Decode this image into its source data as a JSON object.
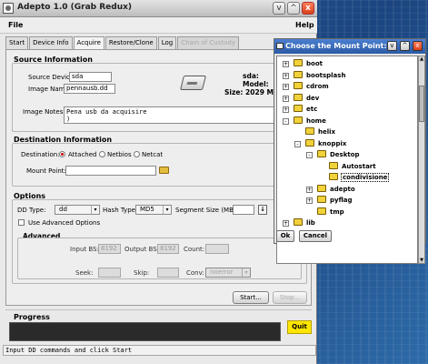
{
  "window": {
    "title": "Adepto 1.0 (Grab Redux)",
    "controls": [
      "v",
      "^",
      "x"
    ]
  },
  "menu": {
    "file": "File",
    "help": "Help"
  },
  "tabs": [
    {
      "label": "Start",
      "state": "normal"
    },
    {
      "label": "Device Info",
      "state": "normal"
    },
    {
      "label": "Acquire",
      "state": "active"
    },
    {
      "label": "Restore/Clone",
      "state": "normal"
    },
    {
      "label": "Log",
      "state": "normal"
    },
    {
      "label": "Chain of Custody",
      "state": "disabled"
    }
  ],
  "source": {
    "title": "Source Information",
    "device_label": "Source Device:",
    "device_value": "sda",
    "image_label": "Image Name:",
    "image_value": "pennausb.dd",
    "info_device": "sda:",
    "info_model": "Model:",
    "info_size": "Size: 2029 MB",
    "notes_label": "Image Notes:",
    "notes_value": "Pena usb da acquisire\n)"
  },
  "destination": {
    "title": "Destination Information",
    "dest_label": "Destination:",
    "options": [
      "Attached",
      "Netbios",
      "Netcat"
    ],
    "selected": "Attached",
    "mount_label": "Mount Point:",
    "mount_value": ""
  },
  "options": {
    "title": "Options",
    "dd_type_label": "DD Type:",
    "dd_type_value": "dd",
    "hash_type_label": "Hash Type:",
    "hash_type_value": "MD5",
    "segment_label": "Segment Size (MB):",
    "segment_value": "",
    "advanced_checkbox_label": "Use Advanced Options",
    "advanced_title": "Advanced",
    "input_bs_label": "Input BS:",
    "input_bs_value": "8192",
    "output_bs_label": "Output BS:",
    "output_bs_value": "8192",
    "count_label": "Count:",
    "count_value": "",
    "seek_label": "Seek:",
    "seek_value": "",
    "skip_label": "Skip:",
    "skip_value": "",
    "conv_label": "Conv:",
    "conv_value": "noerror"
  },
  "actions": {
    "start": "Start...",
    "stop": "Stop..."
  },
  "progress": {
    "title": "Progress",
    "quit": "Quit"
  },
  "status": "Input DD commands and click Start",
  "dialog": {
    "title": "Choose the Mount Point:",
    "controls": [
      "v",
      "^",
      "x"
    ],
    "items": [
      {
        "label": "boot",
        "level": 0,
        "expander": "+"
      },
      {
        "label": "bootsplash",
        "level": 0,
        "expander": "+"
      },
      {
        "label": "cdrom",
        "level": 0,
        "expander": "+"
      },
      {
        "label": "dev",
        "level": 0,
        "expander": "+"
      },
      {
        "label": "etc",
        "level": 0,
        "expander": "+"
      },
      {
        "label": "home",
        "level": 0,
        "expander": "-"
      },
      {
        "label": "helix",
        "level": 1,
        "expander": ""
      },
      {
        "label": "knoppix",
        "level": 1,
        "expander": "-"
      },
      {
        "label": "Desktop",
        "level": 2,
        "expander": "-"
      },
      {
        "label": "Autostart",
        "level": 3,
        "expander": ""
      },
      {
        "label": "condivisione",
        "level": 3,
        "expander": "",
        "selected": true
      },
      {
        "label": "adepto",
        "level": 2,
        "expander": "+"
      },
      {
        "label": "pyflag",
        "level": 2,
        "expander": "+"
      },
      {
        "label": "tmp",
        "level": 2,
        "expander": ""
      },
      {
        "label": "lib",
        "level": 0,
        "expander": "+"
      }
    ],
    "ok": "Ok",
    "cancel": "Cancel"
  },
  "colors": {
    "quit_button": "#ffe600",
    "dialog_title": "#2a5aa6",
    "folder": "#f1d23a",
    "radio_selected": "#cc0000"
  }
}
